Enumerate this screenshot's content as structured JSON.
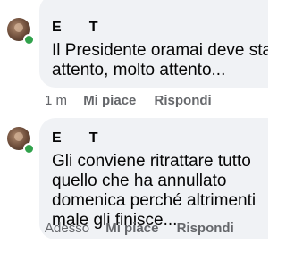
{
  "comments": [
    {
      "author": "E       T",
      "text_lines": [
        "Il Presidente oramai deve sta",
        "attento, molto attento..."
      ],
      "time": "1 m",
      "like_label": "Mi piace",
      "reply_label": "Rispondi"
    },
    {
      "author": "E       T",
      "text_lines": [
        "Gli conviene ritrattare tutto",
        "quello che ha annullato",
        "domenica perché altrimenti",
        "male gli finisce..."
      ],
      "time": "Adesso",
      "like_label": "Mi piace",
      "reply_label": "Rispondi"
    }
  ],
  "colors": {
    "bubble": "#f0f2f5",
    "meta_text": "#65676b",
    "online": "#31a24c",
    "text": "#050505"
  }
}
